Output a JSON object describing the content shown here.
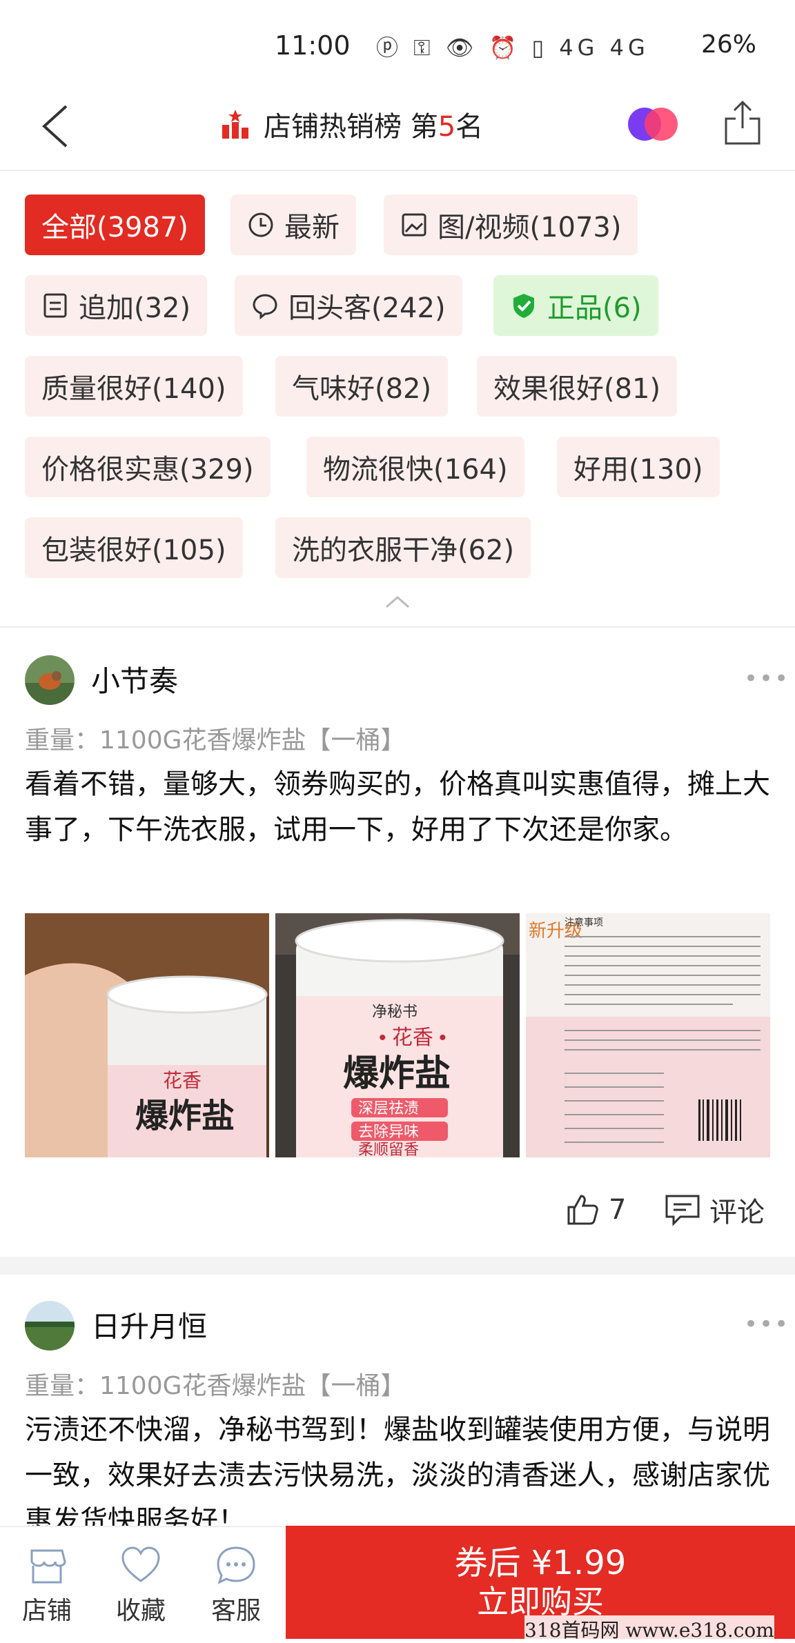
{
  "status_bar": {
    "time": "11:00",
    "icons": "ⓟ ⚿ 👁 ⏰ ▯ 4G 4G",
    "battery": "26%"
  },
  "nav": {
    "title": "店铺热销榜 第",
    "rank": "5",
    "title_suffix": "名"
  },
  "filters": [
    {
      "label": "全部(3987)"
    },
    {
      "label": "最新"
    },
    {
      "label": "图/视频(1073)"
    },
    {
      "label": "追加(32)"
    },
    {
      "label": "回头客(242)"
    },
    {
      "label": "正品(6)"
    },
    {
      "label": "质量很好(140)"
    },
    {
      "label": "气味好(82)"
    },
    {
      "label": "效果很好(81)"
    },
    {
      "label": "价格很实惠(329)"
    },
    {
      "label": "物流很快(164)"
    },
    {
      "label": "好用(130)"
    },
    {
      "label": "包装很好(105)"
    },
    {
      "label": "洗的衣服干净(62)"
    }
  ],
  "reviews": [
    {
      "user": "小节奏",
      "spec": "重量：1100G花香爆炸盐【一桶】",
      "text": "看着不错，量够大，领券购买的，价格真叫实惠值得，摊上大事了，下午洗衣服，试用一下，好用了下次还是你家。",
      "likes": "7",
      "comment_label": "评论",
      "photo_texts": [
        "爆炸盐",
        "花香",
        "净秘书",
        "爆炸盐",
        "深层祛渍",
        "去除异味",
        "柔顺留香",
        "新升级",
        "注意事项"
      ]
    },
    {
      "user": "日升月恒",
      "spec": "重量：1100G花香爆炸盐【一桶】",
      "text": "污渍还不快溜，净秘书驾到！爆盐收到罐装使用方便，与说明一致，效果好去渍去污快易洗，淡淡的清香迷人，感谢店家优惠发货快服务好！"
    }
  ],
  "bottom_bar": {
    "store": "店铺",
    "favorite": "收藏",
    "service": "客服",
    "price_line": "券后 ¥1.99",
    "buy_label": "立即购买"
  },
  "watermark": "318首码网 www.e318.com",
  "colors": {
    "accent": "#e22b23",
    "tag_bg": "#fdeeee",
    "genuine_bg": "#dff7d8",
    "genuine_text": "#1f9b2e"
  }
}
